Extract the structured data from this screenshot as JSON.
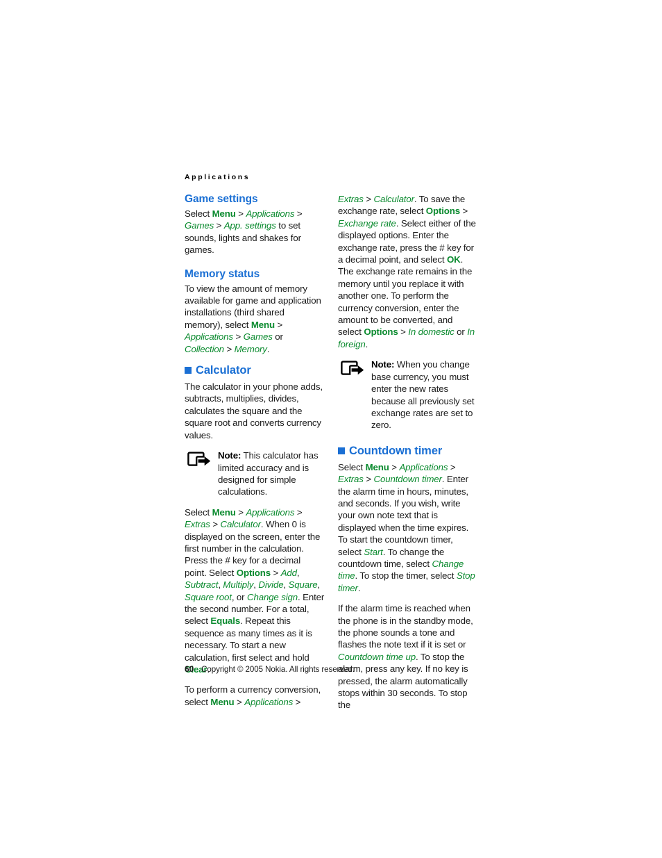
{
  "running_head": "Applications",
  "colors": {
    "heading_blue": "#1a6fd4",
    "ui_green": "#0a8a2e",
    "body_black": "#1a1a1a"
  },
  "left_column": {
    "game_settings": {
      "heading": "Game settings",
      "p1": {
        "t1": "Select ",
        "b1": "Menu",
        "g1": " > ",
        "i1": "Applications",
        "g2": " > ",
        "i2": "Games",
        "g3": " > ",
        "i3": "App. settings",
        "t2": " to set sounds, lights and shakes for games."
      }
    },
    "memory_status": {
      "heading": "Memory status",
      "p1": {
        "t1": "To view the amount of memory available for game and application installations (third shared memory), select ",
        "b1": "Menu",
        "g1": " > ",
        "i1": "Applications",
        "g2": " > ",
        "i2": "Games",
        "t2": " or ",
        "i3": "Collection ",
        "g3": " > ",
        "i4": "Memory",
        "t3": "."
      }
    },
    "calculator": {
      "heading": "Calculator",
      "p1": "The calculator in your phone adds, subtracts, multiplies, divides, calculates the square and the square root and converts currency values.",
      "note": {
        "label": "Note:",
        "text": " This calculator has limited accuracy and is designed for simple calculations."
      },
      "p2": {
        "t1": "Select ",
        "b1": "Menu",
        "g1": " > ",
        "i1": "Applications",
        "g2": " > ",
        "i2": "Extras",
        "g3": " > ",
        "i3": "Calculator",
        "t2": ". When 0 is displayed on the screen, enter the first number in the calculation. Press the # key for a decimal point. Select ",
        "b2": "Options",
        "g4": " > ",
        "i4": "Add",
        "t3": ", ",
        "i5": "Subtract",
        "t4": ", ",
        "i6": "Multiply",
        "t5": ", ",
        "i7": "Divide",
        "t6": ", ",
        "i8": "Square",
        "t7": ", ",
        "i9": "Square root",
        "t8": ", or ",
        "i10": "Change sign",
        "t9": ". Enter the second number. For a total, select ",
        "b3": "Equals",
        "t10": ". Repeat this sequence as many times as it is necessary. To start a new calculation, first select and hold ",
        "b4": "Clear",
        "t11": "."
      },
      "p3": {
        "t1": "To perform a currency conversion, select ",
        "b1": "Menu",
        "g1": " > ",
        "i1": "Applications",
        "g2": " >"
      }
    }
  },
  "right_column": {
    "calculator_cont": {
      "p1": {
        "i1": "Extras",
        "g1": " > ",
        "i2": "Calculator",
        "t1": ". To save the exchange rate, select ",
        "b1": "Options",
        "g2": " > ",
        "i3": "Exchange rate",
        "t2": ". Select either of the displayed options. Enter the exchange rate, press the # key for a decimal point, and select ",
        "b2": "OK",
        "t3": ". The exchange rate remains in the memory until you replace it with another one. To perform the currency conversion, enter the amount to be converted, and select ",
        "b3": "Options",
        "g3": " > ",
        "i4": "In domestic",
        "t4": " or ",
        "i5": "In foreign",
        "t5": "."
      },
      "note": {
        "label": "Note:",
        "text": " When you change base currency, you must enter the new rates because all previously set exchange rates are set to zero."
      }
    },
    "countdown_timer": {
      "heading": "Countdown timer",
      "p1": {
        "t1": "Select ",
        "b1": "Menu",
        "g1": " > ",
        "i1": "Applications",
        "g2": " > ",
        "i2": "Extras",
        "g3": " > ",
        "i3": "Countdown timer",
        "t2": ". Enter the alarm time in hours, minutes, and seconds. If you wish, write your own note text that is displayed when the time expires. To start the countdown timer, select ",
        "i4": "Start",
        "t3": ". To change the countdown time, select ",
        "i5": "Change time",
        "t4": ". To stop the timer, select ",
        "i6": "Stop timer",
        "t5": "."
      },
      "p2": {
        "t1": "If the alarm time is reached when the phone is in the standby mode, the phone sounds a tone and flashes the note text if it is set or ",
        "i1": "Countdown time up",
        "t2": ". To stop the alarm, press any key. If no key is pressed, the alarm automatically stops within 30 seconds. To stop the"
      }
    }
  },
  "footer": {
    "page_number": "60",
    "copyright": "Copyright © 2005 Nokia. All rights reserved."
  }
}
